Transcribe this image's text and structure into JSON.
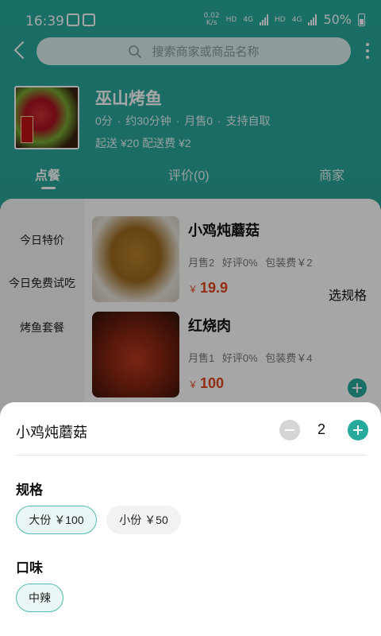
{
  "status_bar": {
    "time": "16:39",
    "speed_top": "0.02",
    "speed_bottom": "K/s",
    "net1": "HD",
    "net2": "4G",
    "net3": "HD",
    "net4": "4G",
    "battery": "50%"
  },
  "search": {
    "placeholder": "搜索商家或商品名称"
  },
  "shop": {
    "name": "巫山烤鱼",
    "meta": "0分 · 约30分钟 · 月售0 · 支持自取",
    "fee": "起送 ¥20 配送费 ¥2"
  },
  "tabs": {
    "order": "点餐",
    "review": "评价(0)",
    "merchant": "商家"
  },
  "categories": [
    "今日特价",
    "今日免费试吃",
    "烤鱼套餐"
  ],
  "items": [
    {
      "name": "小鸡炖蘑菇",
      "meta": "月售2  好评0%  包装费￥2",
      "currency": "￥",
      "price": "19.9",
      "action": "选规格"
    },
    {
      "name": "红烧肉",
      "meta": "月售1  好评0%  包装费￥4",
      "currency": "￥",
      "price": "100"
    }
  ],
  "sheet": {
    "title": "小鸡炖蘑菇",
    "quantity": "2",
    "spec_title": "规格",
    "spec_options": [
      "大份 ￥100",
      "小份 ￥50"
    ],
    "spec_selected": "大份 ￥100",
    "flavor_title": "口味",
    "flavor_options": [
      "中辣"
    ],
    "flavor_selected": "中辣"
  },
  "colors": {
    "accent": "#27a99c",
    "price": "#e0461d"
  }
}
